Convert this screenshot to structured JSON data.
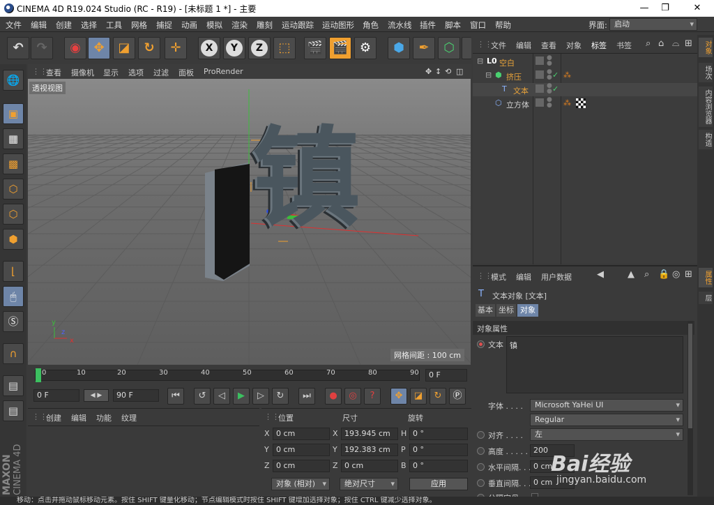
{
  "titlebar": {
    "title": "CINEMA 4D R19.024 Studio (RC - R19) - [未标题 1 *] - 主要",
    "minimize": "—",
    "maximize": "❐",
    "close": "✕"
  },
  "menubar": {
    "items": [
      "文件",
      "编辑",
      "创建",
      "选择",
      "工具",
      "网格",
      "捕捉",
      "动画",
      "模拟",
      "渲染",
      "雕刻",
      "运动跟踪",
      "运动图形",
      "角色",
      "流水线",
      "插件",
      "脚本",
      "窗口",
      "帮助"
    ],
    "layout_label": "界面:",
    "layout_value": "启动"
  },
  "toolbar": {
    "icons": [
      "undo-icon",
      "redo-icon",
      "live-select-icon",
      "move-icon",
      "scale-icon",
      "rotate-icon",
      "last-tool-icon",
      "x-axis-icon",
      "y-axis-icon",
      "z-axis-icon",
      "coordinate-system-icon",
      "render-view-icon",
      "render-picture-viewer-icon",
      "render-settings-icon",
      "cube-icon",
      "pen-icon",
      "subdivision-icon",
      "deformer-icon"
    ],
    "x": "X",
    "y": "Y",
    "z": "Z"
  },
  "viewport": {
    "menus": [
      "查看",
      "摄像机",
      "显示",
      "选项",
      "过滤",
      "面板",
      "ProRender"
    ],
    "label": "透视视图",
    "grid_spacing": "网格间距 : 100 cm",
    "glyph": "镇",
    "axis_x": "x",
    "axis_y": "y",
    "axis_z": "z"
  },
  "timeline": {
    "ticks": [
      "0",
      "10",
      "20",
      "30",
      "40",
      "50",
      "60",
      "70",
      "80",
      "90"
    ],
    "current": "0 F"
  },
  "playback": {
    "start": "0 F",
    "end": "90 F"
  },
  "materials": {
    "menus": [
      "创建",
      "编辑",
      "功能",
      "纹理"
    ]
  },
  "coords": {
    "headers": [
      "位置",
      "尺寸",
      "旋转"
    ],
    "rows": [
      {
        "axis": "X",
        "pos": "0 cm",
        "size_axis": "X",
        "size": "193.945 cm",
        "rot_axis": "H",
        "rot": "0 °"
      },
      {
        "axis": "Y",
        "pos": "0 cm",
        "size_axis": "Y",
        "size": "192.383 cm",
        "rot_axis": "P",
        "rot": "0 °"
      },
      {
        "axis": "Z",
        "pos": "0 cm",
        "size_axis": "Z",
        "size": "0 cm",
        "rot_axis": "B",
        "rot": "0 °"
      }
    ],
    "mode": "对象 (相对)",
    "size_mode": "绝对尺寸",
    "apply": "应用"
  },
  "objects": {
    "menus": [
      "文件",
      "编辑",
      "查看",
      "对象",
      "标签",
      "书签"
    ],
    "items": [
      {
        "name": "空白",
        "icon": "null-icon",
        "color": "#e8a33a"
      },
      {
        "name": "挤压",
        "icon": "extrude-icon",
        "color": "#e8a33a"
      },
      {
        "name": "文本",
        "icon": "text-icon",
        "color": "#e8a33a"
      },
      {
        "name": "立方体",
        "icon": "cube-icon",
        "color": "#d0d0d0"
      }
    ]
  },
  "attributes": {
    "menus": [
      "模式",
      "编辑",
      "用户数据"
    ],
    "object_title": "文本对象 [文本]",
    "tabs": [
      "基本",
      "坐标",
      "对象"
    ],
    "section": "对象属性",
    "text_label": "文本",
    "text_value": "镇",
    "font_label": "字体 . . . .",
    "font": "Microsoft YaHei UI",
    "style": "Regular",
    "align_label": "对齐 . . . .",
    "align": "左",
    "height_label": "高度 . . . . .",
    "height": "200",
    "hspace_label": "水平间隔. . .",
    "hspace": "0 cm",
    "vspace_label": "垂直间隔. . .",
    "vspace": "0 cm",
    "sep_label": "分隔字母. . ."
  },
  "rightstrip": {
    "tabs": [
      "对象",
      "场次",
      "内容浏览器",
      "构造"
    ],
    "tabs2": [
      "属性",
      "层"
    ]
  },
  "brand": {
    "line1": "MAXON",
    "line2": "CINEMA 4D"
  },
  "status": "移动：点击并拖动鼠标移动元素。按住 SHIFT 键量化移动；节点编辑模式时按住 SHIFT 键增加选择对象；按住 CTRL 键减少选择对象。",
  "watermark": {
    "brand": "Bai经验",
    "url": "jingyan.baidu.com"
  },
  "colors": {
    "accent": "#f0a030",
    "selected": "#6e85a8",
    "panel": "#3a3a3a"
  }
}
